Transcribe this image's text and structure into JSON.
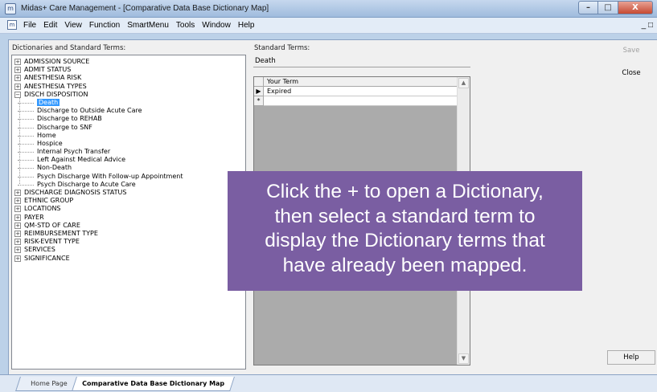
{
  "window": {
    "title": "Midas+ Care Management - [Comparative Data Base Dictionary Map]",
    "min_label": "–",
    "max_label": "□",
    "close_label": "X"
  },
  "menu": {
    "items": [
      "File",
      "Edit",
      "View",
      "Function",
      "SmartMenu",
      "Tools",
      "Window",
      "Help"
    ],
    "mdi_min": "_ □"
  },
  "left_panel": {
    "label": "Dictionaries and Standard Terms:",
    "tree_before": [
      "ADMISSION SOURCE",
      "ADMIT STATUS",
      "ANESTHESIA RISK",
      "ANESTHESIA TYPES"
    ],
    "expanded": {
      "label": "DISCH DISPOSITION",
      "children": [
        "Death",
        "Discharge to Outside Acute Care",
        "Discharge to REHAB",
        "Discharge to SNF",
        "Home",
        "Hospice",
        "Internal Psych Transfer",
        "Left Against Medical Advice",
        "Non-Death",
        "Psych Discharge With Follow-up Appointment",
        "Psych Discharge to Acute Care"
      ],
      "selected_index": 0
    },
    "tree_after": [
      "DISCHARGE DIAGNOSIS STATUS",
      "ETHNIC GROUP",
      "LOCATIONS",
      "PAYER",
      "QM-STD OF CARE",
      "REIMBURSEMENT TYPE",
      "RISK-EVENT TYPE",
      "SERVICES",
      "SIGNIFICANCE"
    ],
    "expand_symbol": "+",
    "collapse_symbol": "−"
  },
  "standard": {
    "label": "Standard Terms:",
    "value": "Death"
  },
  "grid": {
    "column_header": "Your Term",
    "rows": [
      {
        "indicator": "▶",
        "value": "Expired"
      },
      {
        "indicator": "*",
        "value": ""
      }
    ],
    "scroll_up": "▲",
    "scroll_down": "▼"
  },
  "buttons": {
    "save": "Save",
    "close": "Close",
    "help": "Help"
  },
  "tabs": {
    "home": "Home Page",
    "active": "Comparative Data Base Dictionary Map"
  },
  "callout": {
    "lines": [
      "Click the + to open a Dictionary,",
      "then select a standard term to",
      "display the Dictionary terms that",
      "have already been mapped."
    ]
  },
  "colors": {
    "callout_bg": "#7a5ea2",
    "selection": "#3399ff"
  }
}
